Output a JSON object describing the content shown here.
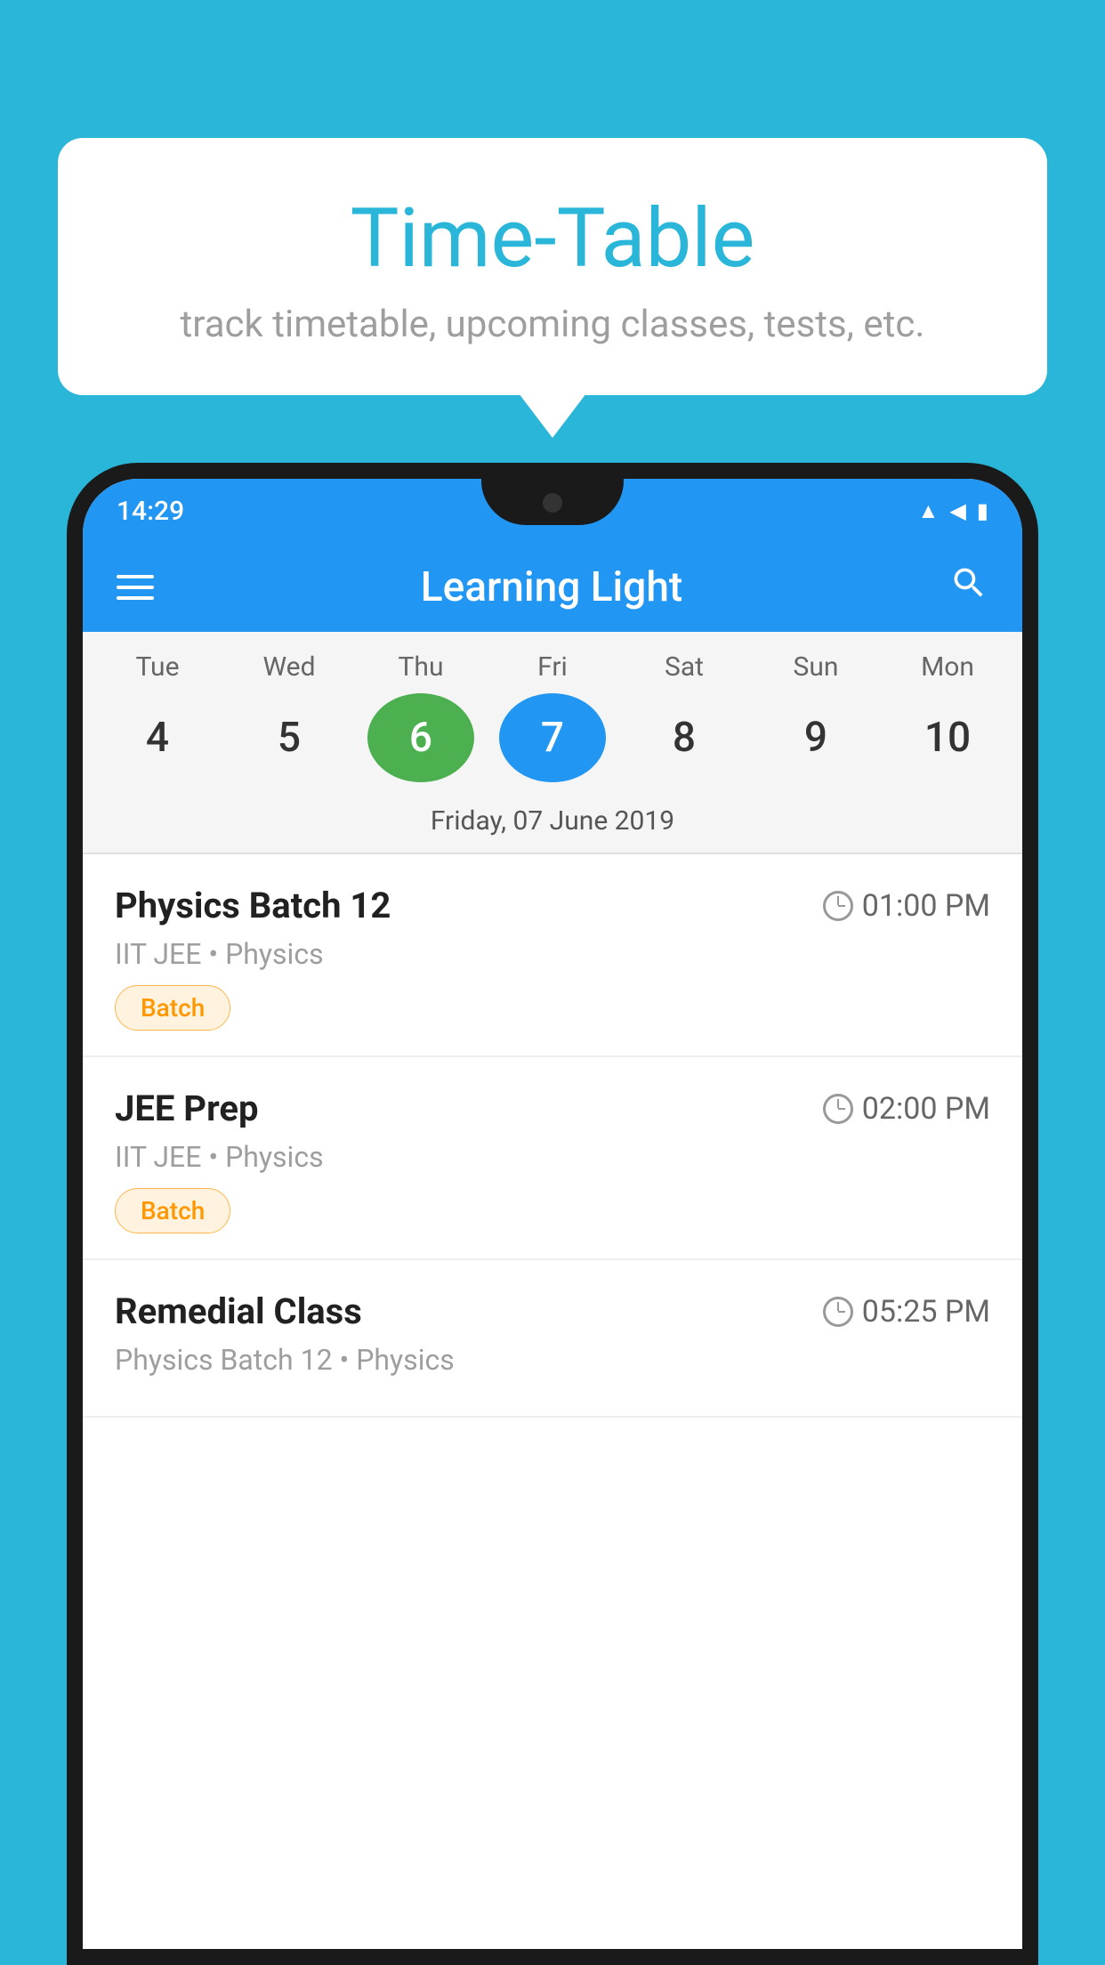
{
  "background_color": "#29B6D8",
  "speech_bubble": {
    "title": "Time-Table",
    "subtitle": "track timetable, upcoming classes, tests, etc."
  },
  "status_bar": {
    "time": "14:29"
  },
  "app_bar": {
    "title": "Learning Light"
  },
  "calendar": {
    "days": [
      {
        "label": "Tue",
        "num": "4"
      },
      {
        "label": "Wed",
        "num": "5"
      },
      {
        "label": "Thu",
        "num": "6",
        "state": "today"
      },
      {
        "label": "Fri",
        "num": "7",
        "state": "selected"
      },
      {
        "label": "Sat",
        "num": "8"
      },
      {
        "label": "Sun",
        "num": "9"
      },
      {
        "label": "Mon",
        "num": "10"
      }
    ],
    "selected_date_label": "Friday, 07 June 2019"
  },
  "schedule_items": [
    {
      "title": "Physics Batch 12",
      "time": "01:00 PM",
      "sub": "IIT JEE • Physics",
      "badge": "Batch"
    },
    {
      "title": "JEE Prep",
      "time": "02:00 PM",
      "sub": "IIT JEE • Physics",
      "badge": "Batch"
    },
    {
      "title": "Remedial Class",
      "time": "05:25 PM",
      "sub": "Physics Batch 12 • Physics",
      "badge": null
    }
  ]
}
